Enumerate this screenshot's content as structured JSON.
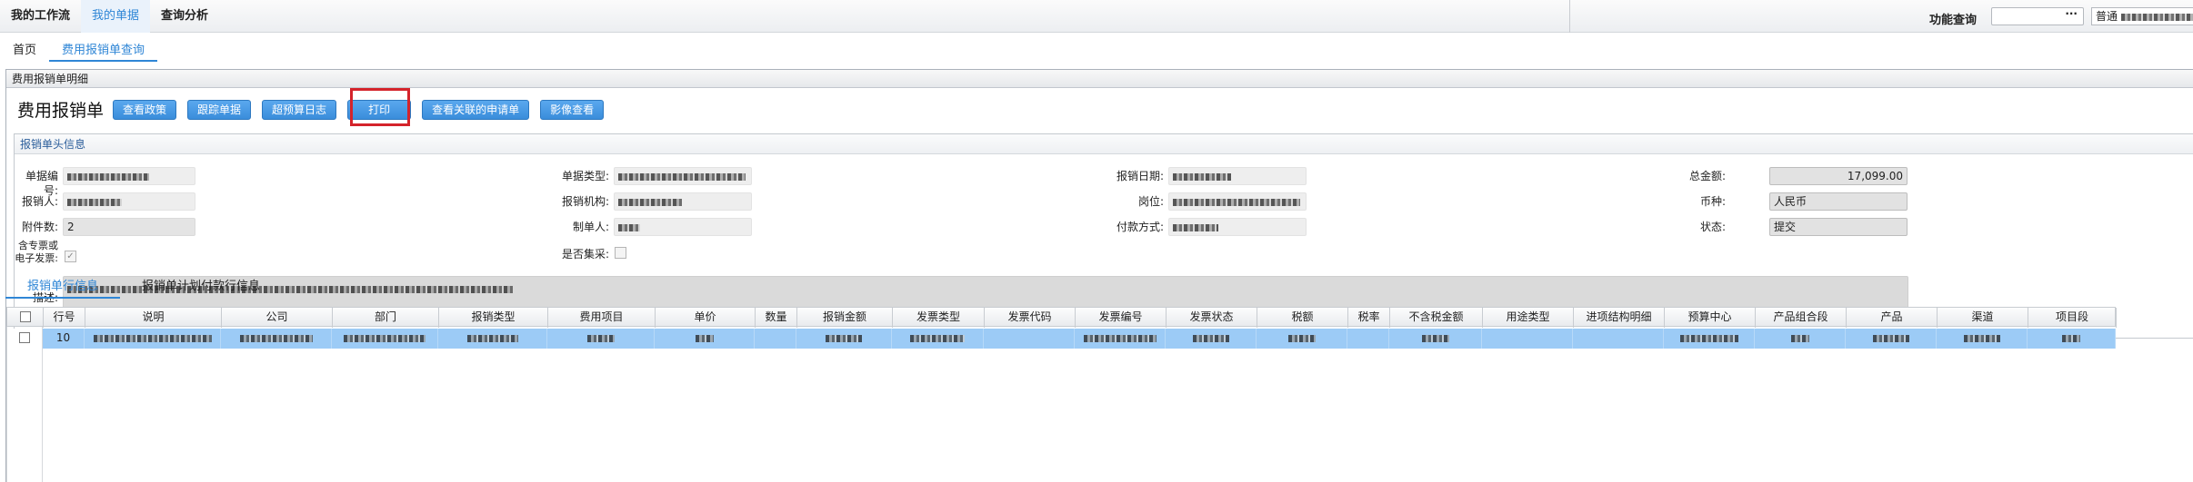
{
  "topnav": {
    "tabs": [
      {
        "label": "我的工作流",
        "active": false
      },
      {
        "label": "我的单据",
        "active": true
      },
      {
        "label": "查询分析",
        "active": false
      }
    ],
    "func_label": "功能查询",
    "func_input_dots": "···",
    "user_prefix": "普通"
  },
  "crumbs": [
    {
      "label": "首页",
      "active": false
    },
    {
      "label": "费用报销单查询",
      "active": true
    }
  ],
  "panel": {
    "title": "费用报销单明细",
    "form_title": "费用报销单",
    "buttons": [
      "查看政策",
      "跟踪单据",
      "超预算日志",
      "打印",
      "查看关联的申请单",
      "影像查看"
    ]
  },
  "header_section": {
    "title": "报销单头信息",
    "labels": {
      "doc_no": "单据编号:",
      "reimburser": "报销人:",
      "attachments": "附件数:",
      "special_invoice": "含专票或电子发票:",
      "description": "描述:",
      "doc_type": "单据类型:",
      "org": "报销机构:",
      "creator": "制单人:",
      "centralized": "是否集采:",
      "date": "报销日期:",
      "position": "岗位:",
      "payment": "付款方式:",
      "total": "总金额:",
      "currency": "币种:",
      "status": "状态:"
    },
    "values": {
      "attachments": "2",
      "total": "17,099.00",
      "currency": "人民币",
      "status": "提交",
      "special_invoice_checked": "✓"
    }
  },
  "bottom_tabs": [
    {
      "label": "报销单行信息",
      "active": true
    },
    {
      "label": "报销单计划付款行信息",
      "active": false
    }
  ],
  "grid": {
    "columns": [
      "",
      "行号",
      "说明",
      "公司",
      "部门",
      "报销类型",
      "费用项目",
      "单价",
      "数量",
      "报销金额",
      "发票类型",
      "发票代码",
      "发票编号",
      "发票状态",
      "税额",
      "税率",
      "不含税金额",
      "用途类型",
      "进项结构明细",
      "预算中心",
      "产品组合段",
      "产品",
      "渠道",
      "项目段"
    ],
    "rows": [
      {
        "line_no": "10"
      }
    ]
  },
  "colors": {
    "accent": "#2f86d6",
    "button": "#3a8ddb",
    "highlight": "#d4232b",
    "selected_row": "#9ccbf6"
  }
}
